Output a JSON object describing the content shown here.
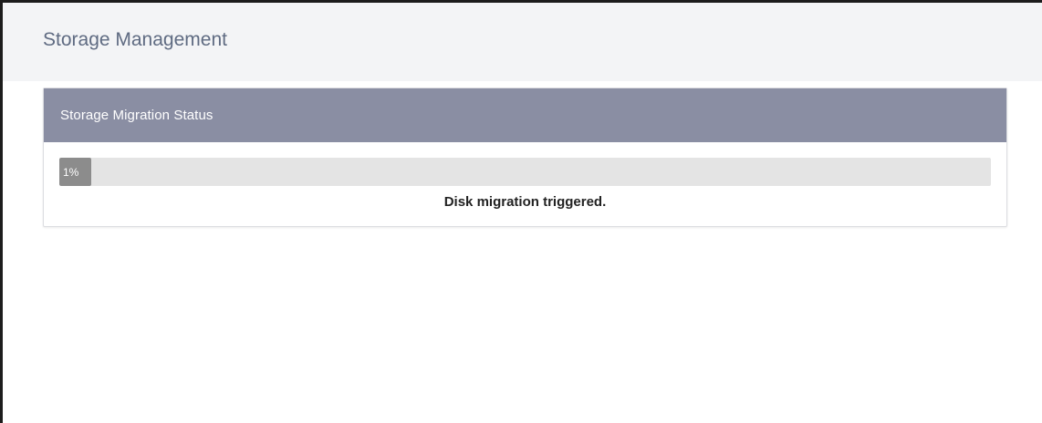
{
  "header": {
    "title": "Storage Management"
  },
  "panel": {
    "title": "Storage Migration Status"
  },
  "progress": {
    "value_percent": 1,
    "label": "1%"
  },
  "status": {
    "message": "Disk migration triggered."
  },
  "colors": {
    "panel_header": "#8a8ea3",
    "progress_fill": "#8c8c8c",
    "progress_track": "#e4e4e4",
    "title_text": "#5f6b82"
  }
}
